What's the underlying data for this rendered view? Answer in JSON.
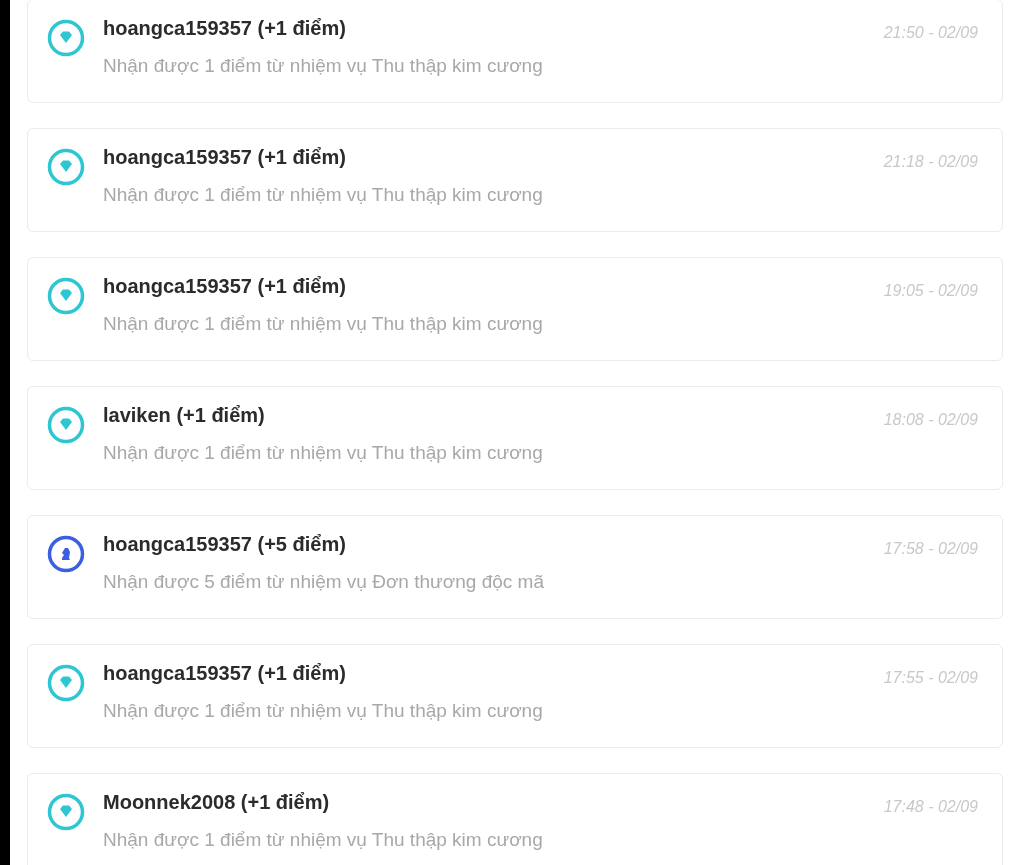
{
  "notifications": [
    {
      "kind": "diamond",
      "title": "hoangca159357 (+1 điểm)",
      "description": "Nhận được 1 điểm từ nhiệm vụ Thu thập kim cương",
      "time": "21:50 - 02/09"
    },
    {
      "kind": "diamond",
      "title": "hoangca159357 (+1 điểm)",
      "description": "Nhận được 1 điểm từ nhiệm vụ Thu thập kim cương",
      "time": "21:18 - 02/09"
    },
    {
      "kind": "diamond",
      "title": "hoangca159357 (+1 điểm)",
      "description": "Nhận được 1 điểm từ nhiệm vụ Thu thập kim cương",
      "time": "19:05 - 02/09"
    },
    {
      "kind": "diamond",
      "title": "laviken (+1 điểm)",
      "description": "Nhận được 1 điểm từ nhiệm vụ Thu thập kim cương",
      "time": "18:08 - 02/09"
    },
    {
      "kind": "knight",
      "title": "hoangca159357 (+5 điểm)",
      "description": "Nhận được 5 điểm từ nhiệm vụ Đơn thương độc mã",
      "time": "17:58 - 02/09"
    },
    {
      "kind": "diamond",
      "title": "hoangca159357 (+1 điểm)",
      "description": "Nhận được 1 điểm từ nhiệm vụ Thu thập kim cương",
      "time": "17:55 - 02/09"
    },
    {
      "kind": "diamond",
      "title": "Moonnek2008 (+1 điểm)",
      "description": "Nhận được 1 điểm từ nhiệm vụ Thu thập kim cương",
      "time": "17:48 - 02/09"
    }
  ]
}
